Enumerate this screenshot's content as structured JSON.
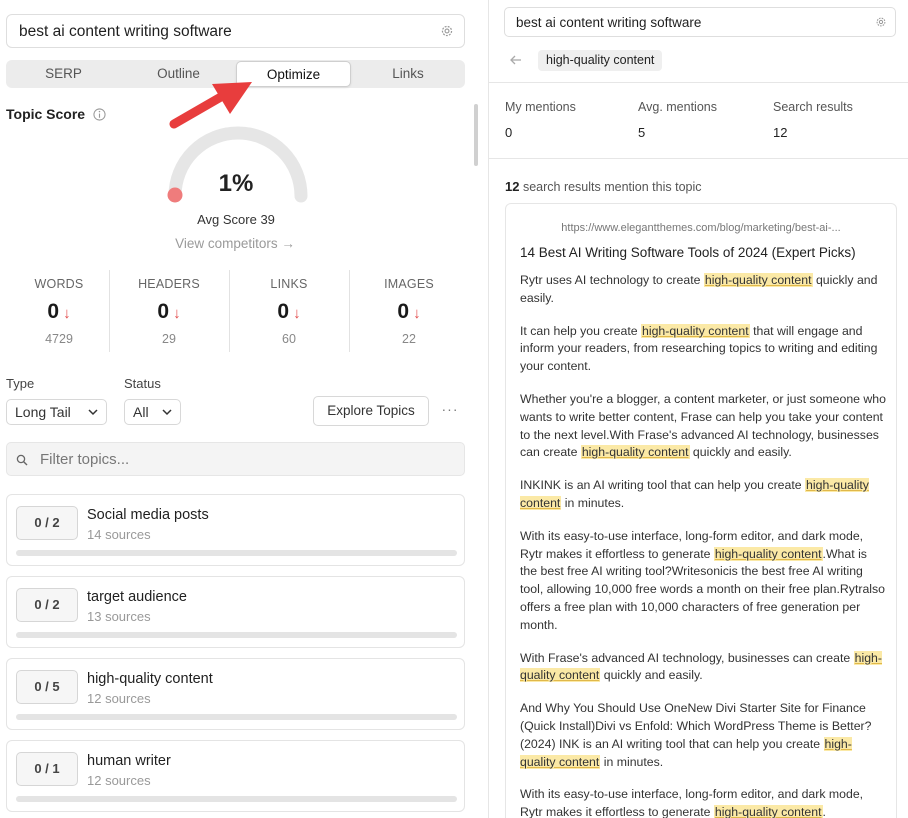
{
  "query": "best ai content writing software",
  "tabs": [
    {
      "label": "SERP"
    },
    {
      "label": "Outline"
    },
    {
      "label": "Optimize"
    },
    {
      "label": "Links"
    }
  ],
  "topic_score": {
    "title": "Topic Score",
    "value": "1%",
    "avg_score_label": "Avg Score 39",
    "view_competitors": "View competitors →"
  },
  "stats": [
    {
      "label": "WORDS",
      "value": "0",
      "target": "4729"
    },
    {
      "label": "HEADERS",
      "value": "0",
      "target": "29"
    },
    {
      "label": "LINKS",
      "value": "0",
      "target": "60"
    },
    {
      "label": "IMAGES",
      "value": "0",
      "target": "22"
    }
  ],
  "filters": {
    "type_label": "Type",
    "type_value": "Long Tail",
    "status_label": "Status",
    "status_value": "All",
    "explore_button": "Explore Topics",
    "more_button": "···",
    "search_placeholder": "Filter topics..."
  },
  "topics": [
    {
      "count": "0 / 2",
      "name": "Social media posts",
      "sources": "14 sources"
    },
    {
      "count": "0 / 2",
      "name": "target audience",
      "sources": "13 sources"
    },
    {
      "count": "0 / 5",
      "name": "high-quality content",
      "sources": "12 sources"
    },
    {
      "count": "0 / 1",
      "name": "human writer",
      "sources": "12 sources"
    }
  ],
  "detail": {
    "query": "best ai content writing software",
    "chip": "high-quality content",
    "metrics": [
      {
        "label": "My mentions",
        "value": "0"
      },
      {
        "label": "Avg. mentions",
        "value": "5"
      },
      {
        "label": "Search results",
        "value": "12"
      }
    ],
    "mention_count": "12",
    "mention_text": "search results mention this topic",
    "result": {
      "url": "https://www.elegantthemes.com/blog/marketing/best-ai-...",
      "title": "14 Best AI Writing Software Tools of 2024 (Expert Picks)"
    }
  },
  "colors": {
    "accent_red": "#e24b4b",
    "highlight": "#fbe9a6",
    "gauge_track": "#e6e6e6"
  }
}
